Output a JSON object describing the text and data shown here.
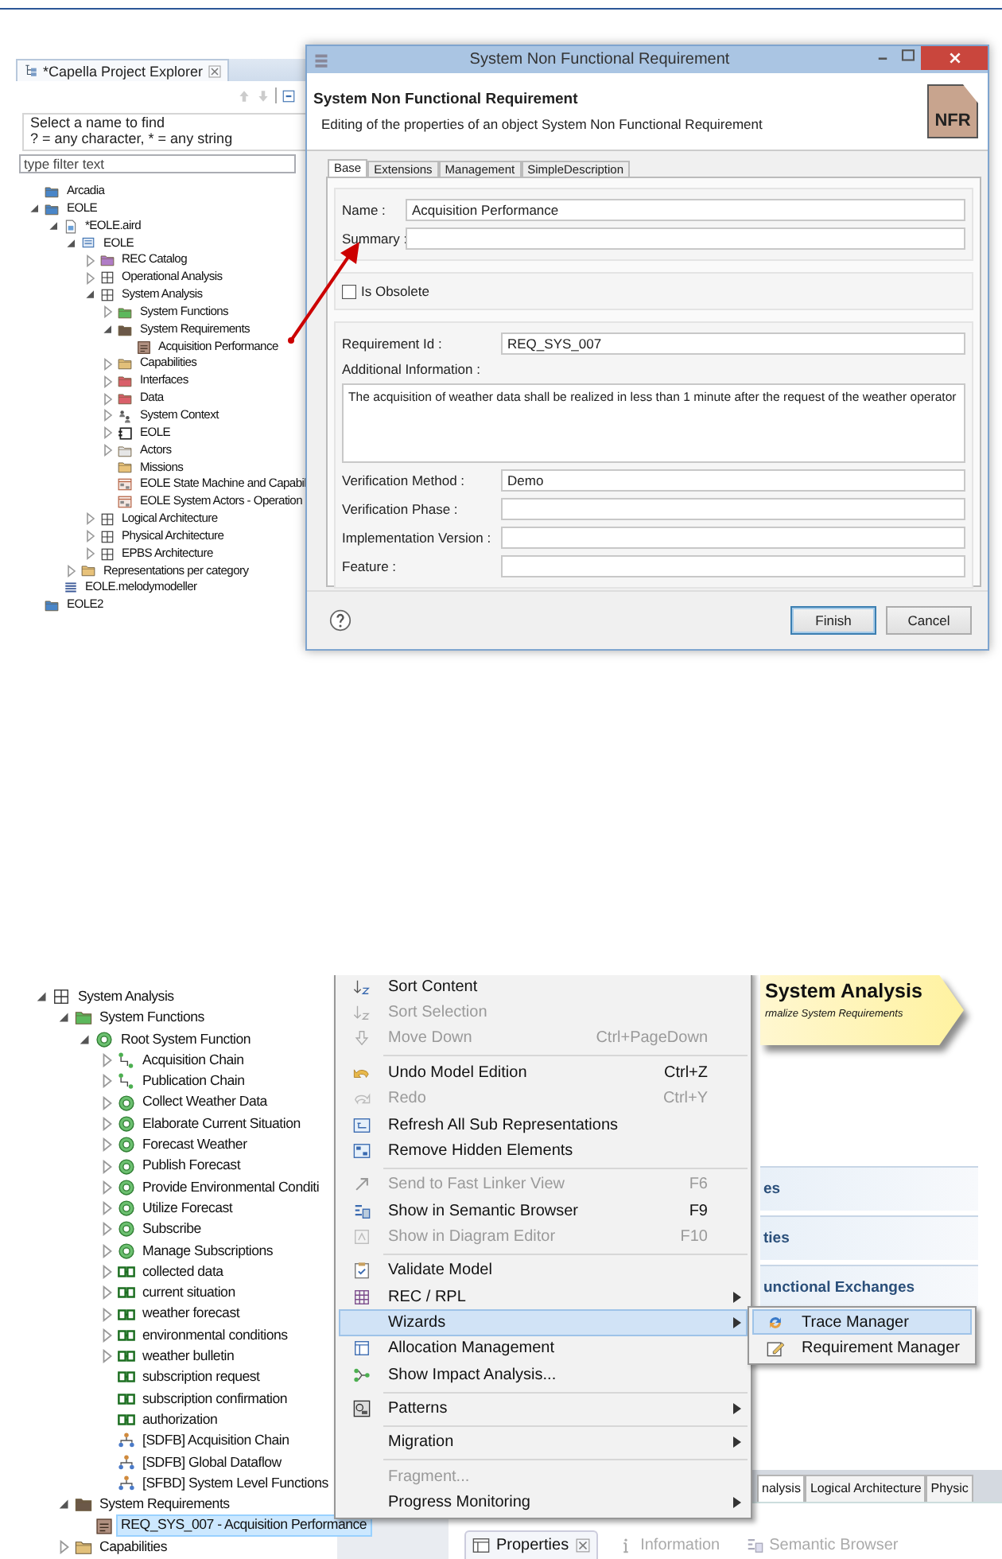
{
  "explorer": {
    "title": "*Capella Project Explorer",
    "filter_title": "Select a name to find",
    "filter_hint": "? = any character, * = any string",
    "filter": {
      "placeholder": "type filter text"
    },
    "tree": [
      {
        "label": "Arcadia",
        "kind": "folder",
        "color": "#4a86c8"
      },
      {
        "label": "EOLE",
        "kind": "folder",
        "color": "#4a86c8",
        "expanded": true,
        "children": [
          {
            "label": "*EOLE.aird",
            "kind": "file",
            "expanded": true,
            "children": [
              {
                "label": "EOLE",
                "kind": "model",
                "expanded": true,
                "children": [
                  {
                    "label": "REC Catalog",
                    "kind": "folder",
                    "color": "#b07cc6",
                    "expanded": false
                  },
                  {
                    "label": "Operational Analysis",
                    "kind": "package",
                    "expanded": false
                  },
                  {
                    "label": "System Analysis",
                    "kind": "package",
                    "expanded": true,
                    "children": [
                      {
                        "label": "System Functions",
                        "kind": "folder",
                        "color": "#5cb85c",
                        "expanded": false
                      },
                      {
                        "label": "System Requirements",
                        "kind": "folder",
                        "color": "#6b5848",
                        "expanded": true,
                        "children": [
                          {
                            "label": "Acquisition Performance",
                            "kind": "requirement"
                          }
                        ]
                      },
                      {
                        "label": "Capabilities",
                        "kind": "folder",
                        "color": "#e2c07a",
                        "expanded": false
                      },
                      {
                        "label": "Interfaces",
                        "kind": "folder",
                        "color": "#d9606a",
                        "expanded": false
                      },
                      {
                        "label": "Data",
                        "kind": "folder",
                        "color": "#d9606a",
                        "expanded": false
                      },
                      {
                        "label": "System Context",
                        "kind": "context",
                        "expanded": false
                      },
                      {
                        "label": "EOLE",
                        "kind": "component",
                        "expanded": false
                      },
                      {
                        "label": "Actors",
                        "kind": "folder",
                        "color": "#e6e6e6",
                        "expanded": false
                      },
                      {
                        "label": "Missions",
                        "kind": "folder",
                        "color": "#e8c27a"
                      },
                      {
                        "label": "EOLE State Machine and Capabil",
                        "kind": "diagram"
                      },
                      {
                        "label": "EOLE System Actors - Operation",
                        "kind": "diagram"
                      }
                    ]
                  },
                  {
                    "label": "Logical Architecture",
                    "kind": "package",
                    "expanded": false
                  },
                  {
                    "label": "Physical Architecture",
                    "kind": "package",
                    "expanded": false
                  },
                  {
                    "label": "EPBS Architecture",
                    "kind": "package",
                    "expanded": false
                  }
                ]
              },
              {
                "label": "Representations per category",
                "kind": "folder",
                "color": "#e8c27a",
                "expanded": false
              }
            ]
          },
          {
            "label": "EOLE.melodymodeller",
            "kind": "lines"
          }
        ]
      },
      {
        "label": "EOLE2",
        "kind": "folder",
        "color": "#4a86c8"
      }
    ]
  },
  "dialog": {
    "title": "System Non Functional Requirement",
    "heading": "System Non Functional Requirement",
    "description": "Editing of the properties of an object System Non Functional Requirement",
    "badge": "NFR",
    "tabs": [
      {
        "label": "Base",
        "selected": true
      },
      {
        "label": "Extensions",
        "selected": false
      },
      {
        "label": "Management",
        "selected": false
      },
      {
        "label": "SimpleDescription",
        "selected": false
      }
    ],
    "groups": [
      {
        "fields": [
          {
            "kind": "text",
            "label": "Name :",
            "value": "Acquisition Performance"
          },
          {
            "kind": "text",
            "label": "Summary :"
          }
        ]
      },
      {
        "fields": [
          {
            "kind": "checkbox",
            "label": "Is Obsolete",
            "checked": false
          }
        ]
      },
      {
        "fields": [
          {
            "kind": "text",
            "label": "Requirement Id :",
            "value": "REQ_SYS_007"
          },
          {
            "kind": "textarea",
            "label": "Additional Information :",
            "value": "The acquisition of weather data shall be realized in less than 1 minute after the request of the weather operator"
          },
          {
            "kind": "text",
            "label": "Verification Method :",
            "value": "Demo"
          },
          {
            "kind": "text",
            "label": "Verification Phase :"
          },
          {
            "kind": "text",
            "label": "Implementation Version :"
          },
          {
            "kind": "text",
            "label": "Feature :"
          }
        ]
      }
    ],
    "buttons": [
      {
        "label": "Finish",
        "default": true
      },
      {
        "label": "Cancel",
        "default": false
      }
    ]
  },
  "outline_tree": [
    {
      "label": "System Analysis",
      "kind": "package",
      "expanded": true,
      "selected": false,
      "children": [
        {
          "label": "System Functions",
          "kind": "folder",
          "color": "#5cb85c",
          "expanded": true,
          "selected": false,
          "children": [
            {
              "label": "Root System Function",
              "kind": "function",
              "expanded": true,
              "selected": false,
              "children": [
                {
                  "label": "Acquisition Chain",
                  "kind": "chain",
                  "expanded": false,
                  "selected": false
                },
                {
                  "label": "Publication Chain",
                  "kind": "chain",
                  "expanded": false,
                  "selected": false
                },
                {
                  "label": "Collect Weather Data",
                  "kind": "function",
                  "expanded": false,
                  "selected": false
                },
                {
                  "label": "Elaborate Current Situation",
                  "kind": "function",
                  "expanded": false,
                  "selected": false
                },
                {
                  "label": "Forecast Weather",
                  "kind": "function",
                  "expanded": false,
                  "selected": false
                },
                {
                  "label": "Publish Forecast",
                  "kind": "function",
                  "expanded": false,
                  "selected": false
                },
                {
                  "label": "Provide Environmental Conditi",
                  "kind": "function",
                  "expanded": false,
                  "selected": false
                },
                {
                  "label": "Utilize Forecast",
                  "kind": "function",
                  "expanded": false,
                  "selected": false
                },
                {
                  "label": "Subscribe",
                  "kind": "function",
                  "expanded": false,
                  "selected": false
                },
                {
                  "label": "Manage Subscriptions",
                  "kind": "function",
                  "expanded": false,
                  "selected": false
                },
                {
                  "label": "collected data",
                  "kind": "exchange",
                  "expanded": false,
                  "selected": false
                },
                {
                  "label": "current situation",
                  "kind": "exchange",
                  "expanded": false,
                  "selected": false
                },
                {
                  "label": "weather forecast",
                  "kind": "exchange",
                  "expanded": false,
                  "selected": false
                },
                {
                  "label": "environmental conditions",
                  "kind": "exchange",
                  "expanded": false,
                  "selected": false
                },
                {
                  "label": "weather bulletin",
                  "kind": "exchange",
                  "expanded": false,
                  "selected": false
                },
                {
                  "label": "subscription request",
                  "kind": "exchange",
                  "selected": false
                },
                {
                  "label": "subscription confirmation",
                  "kind": "exchange",
                  "selected": false
                },
                {
                  "label": "authorization",
                  "kind": "exchange",
                  "selected": false
                },
                {
                  "label": "[SDFB] Acquisition Chain",
                  "kind": "dataflow",
                  "selected": false
                },
                {
                  "label": "[SDFB] Global Dataflow",
                  "kind": "dataflow",
                  "selected": false
                },
                {
                  "label": "[SFBD] System Level Functions",
                  "kind": "dataflow",
                  "selected": false
                }
              ]
            }
          ]
        },
        {
          "label": "System Requirements",
          "kind": "folder",
          "color": "#6b5848",
          "expanded": true,
          "selected": false,
          "children": [
            {
              "label": "REQ_SYS_007 - Acquisition Performance",
              "kind": "requirement",
              "selected": true
            }
          ]
        },
        {
          "label": "Capabilities",
          "kind": "folder",
          "color": "#e2c07a",
          "expanded": false,
          "selected": false
        }
      ]
    }
  ],
  "diagram": {
    "title": "System Analysis",
    "subtitle": "rmalize System Requirements",
    "sections": [
      "es",
      "ties",
      "unctional Exchanges"
    ]
  },
  "editor_tabs": [
    {
      "label": "nalysis",
      "selected": true
    },
    {
      "label": "Logical Architecture",
      "selected": false
    },
    {
      "label": "Physic",
      "selected": false
    }
  ],
  "views": [
    {
      "label": "Properties",
      "selected": true,
      "disabled": false
    },
    {
      "label": "Information",
      "selected": false,
      "disabled": true
    },
    {
      "label": "Semantic Browser",
      "selected": false,
      "disabled": true
    }
  ],
  "context_menu": [
    {
      "kind": "item",
      "label": "Sort Content",
      "disabled": false,
      "submenu": false,
      "selected": false
    },
    {
      "kind": "item",
      "label": "Sort Selection",
      "disabled": true,
      "submenu": false,
      "selected": false
    },
    {
      "kind": "item",
      "label": "Move Down",
      "shortcut": "Ctrl+PageDown",
      "disabled": true,
      "submenu": false,
      "selected": false
    },
    {
      "kind": "separator"
    },
    {
      "kind": "item",
      "label": "Undo Model Edition",
      "shortcut": "Ctrl+Z",
      "disabled": false,
      "submenu": false,
      "selected": false
    },
    {
      "kind": "item",
      "label": "Redo",
      "shortcut": "Ctrl+Y",
      "disabled": true,
      "submenu": false,
      "selected": false
    },
    {
      "kind": "item",
      "label": "Refresh All Sub Representations",
      "disabled": false,
      "submenu": false,
      "selected": false
    },
    {
      "kind": "item",
      "label": "Remove Hidden Elements",
      "disabled": false,
      "submenu": false,
      "selected": false
    },
    {
      "kind": "separator"
    },
    {
      "kind": "item",
      "label": "Send to Fast Linker View",
      "shortcut": "F6",
      "disabled": true,
      "submenu": false,
      "selected": false
    },
    {
      "kind": "item",
      "label": "Show in Semantic Browser",
      "shortcut": "F9",
      "disabled": false,
      "submenu": false,
      "selected": false
    },
    {
      "kind": "item",
      "label": "Show in Diagram Editor",
      "shortcut": "F10",
      "disabled": true,
      "submenu": false,
      "selected": false
    },
    {
      "kind": "separator"
    },
    {
      "kind": "item",
      "label": "Validate Model",
      "disabled": false,
      "submenu": false,
      "selected": false
    },
    {
      "kind": "item",
      "label": "REC / RPL",
      "disabled": false,
      "submenu": true,
      "selected": false
    },
    {
      "kind": "item",
      "label": "Wizards",
      "disabled": false,
      "submenu": true,
      "selected": true
    },
    {
      "kind": "item",
      "label": "Allocation Management",
      "disabled": false,
      "submenu": false,
      "selected": false
    },
    {
      "kind": "item",
      "label": "Show Impact Analysis...",
      "disabled": false,
      "submenu": false,
      "selected": false
    },
    {
      "kind": "separator"
    },
    {
      "kind": "item",
      "label": "Patterns",
      "disabled": false,
      "submenu": true,
      "selected": false
    },
    {
      "kind": "separator"
    },
    {
      "kind": "item",
      "label": "Migration",
      "disabled": false,
      "submenu": true,
      "selected": false
    },
    {
      "kind": "separator"
    },
    {
      "kind": "item",
      "label": "Fragment...",
      "disabled": true,
      "submenu": false,
      "selected": false
    },
    {
      "kind": "item",
      "label": "Progress Monitoring",
      "disabled": false,
      "submenu": true,
      "selected": false
    }
  ],
  "submenu": [
    {
      "label": "Trace Manager",
      "selected": true
    },
    {
      "label": "Requirement Manager",
      "selected": false
    }
  ]
}
